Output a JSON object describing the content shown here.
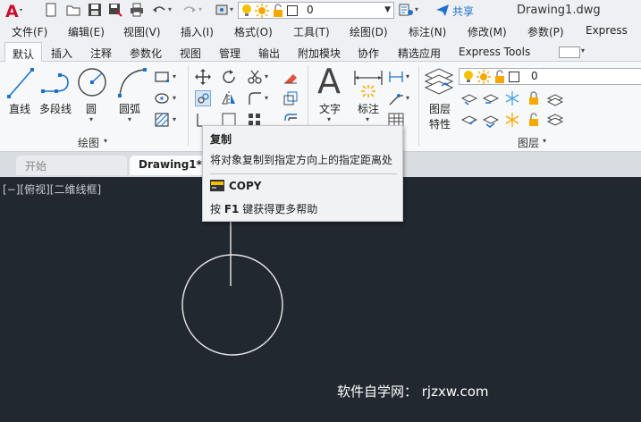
{
  "title": {
    "filename": "Drawing1.dwg",
    "share": "共享",
    "layer_value": "0"
  },
  "menus": [
    "文件(F)",
    "编辑(E)",
    "视图(V)",
    "插入(I)",
    "格式(O)",
    "工具(T)",
    "绘图(D)",
    "标注(N)",
    "修改(M)",
    "参数(P)",
    "Express"
  ],
  "ribbon_tabs": [
    "默认",
    "插入",
    "注释",
    "参数化",
    "视图",
    "管理",
    "输出",
    "附加模块",
    "协作",
    "精选应用",
    "Express Tools"
  ],
  "draw_panel": {
    "tools": [
      "直线",
      "多段线",
      "圆",
      "圆弧"
    ],
    "title": "绘图"
  },
  "annotation_panel": {
    "text": "文字",
    "dimension": "标注"
  },
  "layers_panel": {
    "props_line1": "图层",
    "props_line2": "特性",
    "layer_value": "0",
    "title": "图层"
  },
  "doc_tabs": [
    "开始",
    "Drawing1*"
  ],
  "viewport_label": "[−][俯视][二维线框]",
  "tooltip": {
    "title": "复制",
    "description": "将对象复制到指定方向上的指定距离处",
    "command": "COPY",
    "help_prefix": "按 ",
    "help_key": "F1",
    "help_suffix": " 键获得更多帮助"
  },
  "watermark": "软件自学网： rjzxw.com",
  "colors": {
    "canvas": "#212830",
    "accent_blue": "#1f72c8",
    "app_red": "#c8102e"
  }
}
